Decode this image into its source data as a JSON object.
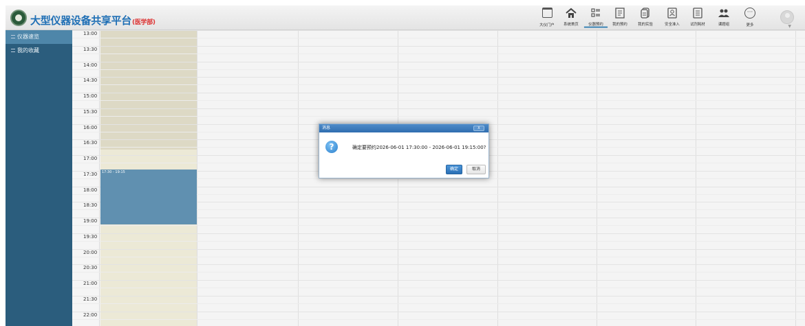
{
  "header": {
    "title": "大型仪器设备共享平台",
    "subtitle": "(医学部)",
    "nav": [
      {
        "label": "大仪门户",
        "icon": "portal-window-icon"
      },
      {
        "label": "系统首页",
        "icon": "home-icon"
      },
      {
        "label": "仪器预约",
        "icon": "list-icon",
        "active": true
      },
      {
        "label": "我的预约",
        "icon": "document-edit-icon"
      },
      {
        "label": "我的实验",
        "icon": "documents-icon"
      },
      {
        "label": "安全准入",
        "icon": "badge-icon"
      },
      {
        "label": "试剂耗材",
        "icon": "notes-icon"
      },
      {
        "label": "课题组",
        "icon": "group-icon"
      },
      {
        "label": "更多",
        "icon": "more-icon"
      }
    ]
  },
  "sidebar": {
    "items": [
      {
        "label": "仪器速览",
        "active": true
      },
      {
        "label": "我的收藏",
        "active": false
      }
    ]
  },
  "calendar": {
    "times": [
      "13:00",
      "13:30",
      "14:00",
      "14:30",
      "15:00",
      "15:30",
      "16:00",
      "16:30",
      "17:00",
      "17:30",
      "18:00",
      "18:30",
      "19:00",
      "19:30",
      "20:00",
      "20:30",
      "21:00",
      "21:30",
      "22:00"
    ],
    "event_label": "17:30 - 19:15"
  },
  "dialog": {
    "title": "消息",
    "close": "X",
    "icon": "question-icon",
    "message": "确定要预约2026-06-01 17:30:00 - 2026-06-01 19:15:00?",
    "ok": "确定",
    "cancel": "取消"
  }
}
